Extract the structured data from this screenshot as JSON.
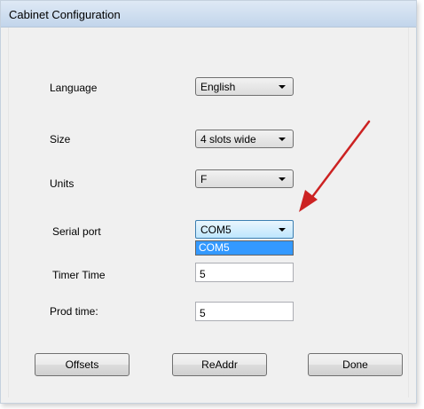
{
  "window": {
    "title": "Cabinet Configuration"
  },
  "fields": {
    "language": {
      "label": "Language",
      "selected": "English"
    },
    "size": {
      "label": "Size",
      "selected": "4 slots wide"
    },
    "units": {
      "label": "Units",
      "selected": "F"
    },
    "serial_port": {
      "label": "Serial port",
      "selected": "COM5",
      "dropdown_open": true,
      "options": [
        "COM5"
      ]
    },
    "timer_time": {
      "label": "Timer Time",
      "value": "5"
    },
    "prod_time": {
      "label": "Prod time:",
      "value": "5"
    }
  },
  "buttons": {
    "offsets": "Offsets",
    "readdr": "ReAddr",
    "done": "Done"
  },
  "annotation": {
    "arrow_color": "#cc2222"
  },
  "colors": {
    "selection": "#3399ff",
    "titlebar": "#c2d5eb"
  }
}
